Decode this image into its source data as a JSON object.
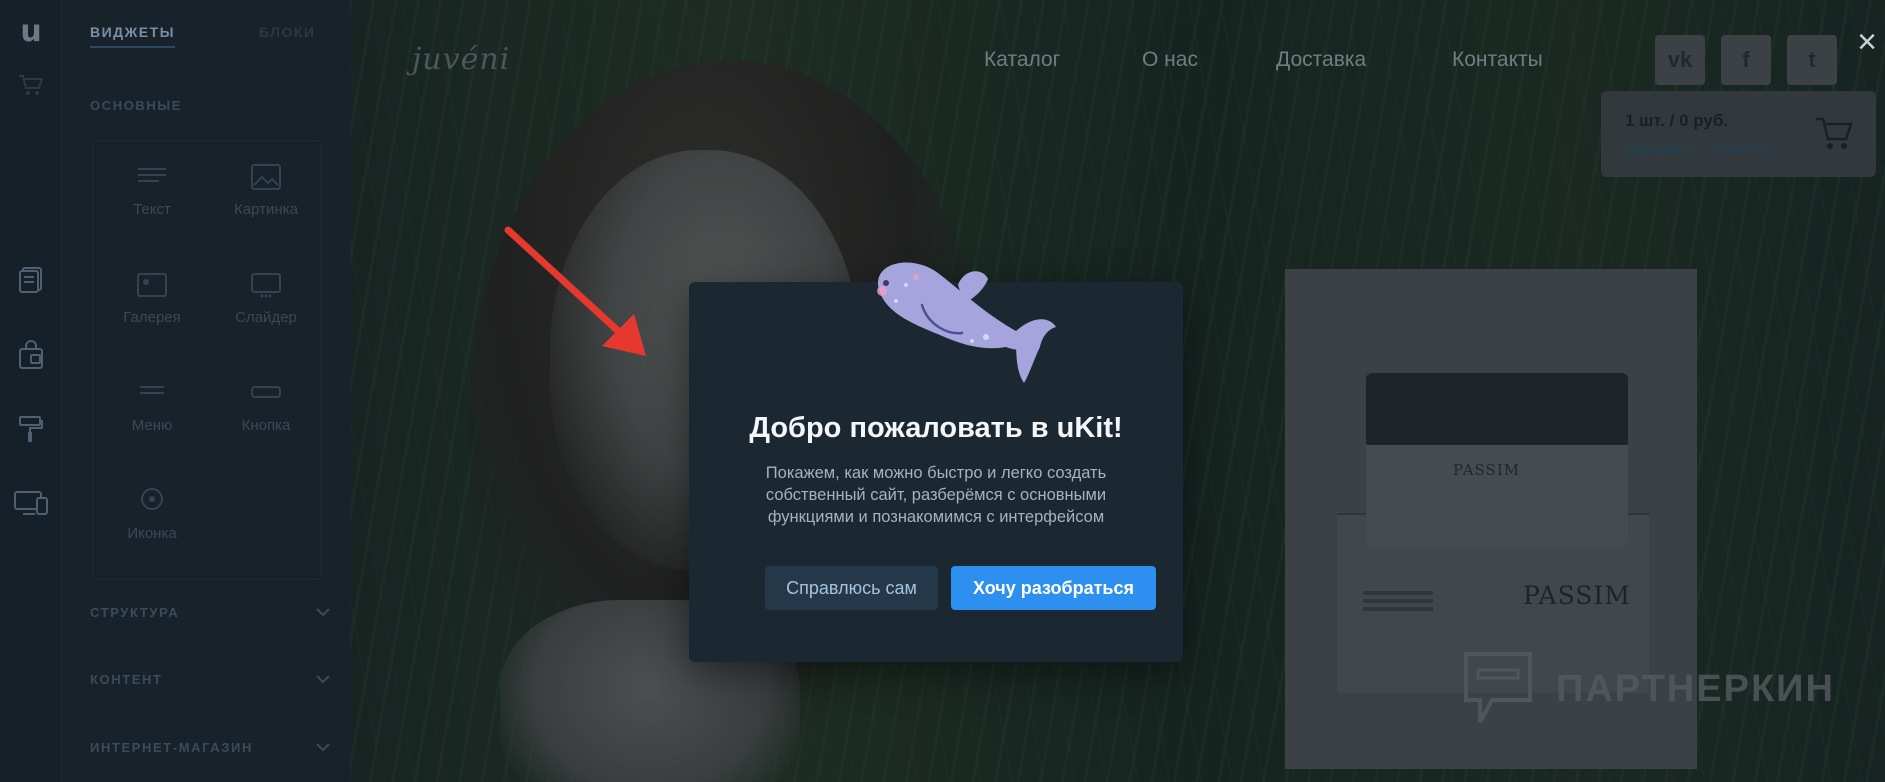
{
  "sidebar": {
    "logo": "u",
    "tabs": {
      "widgets": "ВИДЖЕТЫ",
      "blocks": "БЛОКИ"
    },
    "basic_title": "ОСНОВНЫЕ",
    "widgets": [
      {
        "label": "Текст",
        "icon": "text-lines-icon"
      },
      {
        "label": "Картинка",
        "icon": "image-icon"
      },
      {
        "label": "Галерея",
        "icon": "gallery-icon"
      },
      {
        "label": "Слайдер",
        "icon": "slider-icon"
      },
      {
        "label": "Меню",
        "icon": "menu-icon"
      },
      {
        "label": "Кнопка",
        "icon": "button-icon"
      },
      {
        "label": "Иконка",
        "icon": "icon-icon"
      }
    ],
    "accordions": [
      "СТРУКТУРА",
      "КОНТЕНТ",
      "ИНТЕРНЕТ-МАГАЗИН"
    ]
  },
  "site": {
    "brand": "juvéni",
    "nav": [
      "Каталог",
      "О нас",
      "Доставка",
      "Контакты"
    ],
    "social": [
      "vk-icon",
      "facebook-icon",
      "twitter-icon"
    ],
    "social_glyphs": [
      "vk",
      "f",
      "t"
    ],
    "cart": {
      "summary": "1 шт. / 0 руб.",
      "checkout": "Оформить",
      "clear": "Очистить"
    },
    "product": {
      "label_jar": "PASSIM",
      "label_box": "PASSIM"
    },
    "watermark": "ПАРТНЕРКИН"
  },
  "modal": {
    "title": "Добро пожаловать в uKit!",
    "description": "Покажем, как можно быстро и легко создать собственный сайт, разберёмся с основными функциями и познакомимся с интерфейсом",
    "secondary_button": "Справлюсь сам",
    "primary_button": "Хочу разобраться",
    "close": "×"
  },
  "colors": {
    "accent": "#2d8ff0",
    "modal_bg": "#1b2731",
    "arrow": "#e5392f"
  }
}
